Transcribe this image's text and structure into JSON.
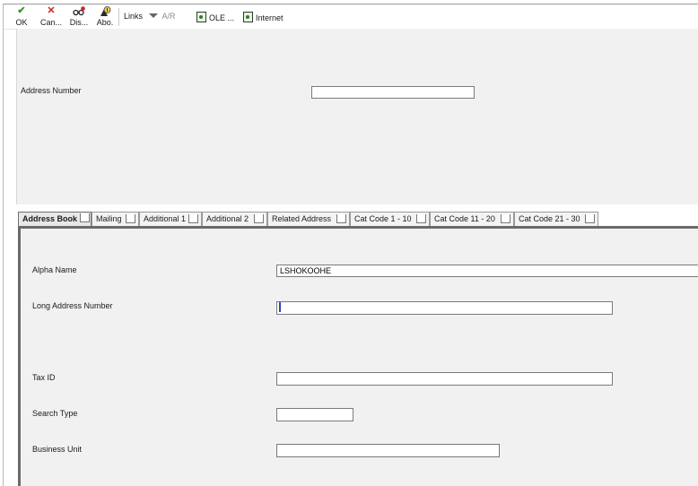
{
  "toolbar": {
    "ok_label": "OK",
    "cancel_label": "Can...",
    "display_label": "Dis...",
    "about_label": "Abo.",
    "links_label": "Links",
    "ar_label": "A/R",
    "ole_label": "OLE ...",
    "internet_label": "Internet"
  },
  "header": {
    "address_number_label": "Address Number",
    "address_number_value": ""
  },
  "tabs": [
    {
      "label": "Address Book"
    },
    {
      "label": "Mailing"
    },
    {
      "label": "Additional 1"
    },
    {
      "label": "Additional 2"
    },
    {
      "label": "Related Address"
    },
    {
      "label": "Cat Code 1 - 10"
    },
    {
      "label": "Cat Code 11 - 20"
    },
    {
      "label": "Cat Code 21 - 30"
    }
  ],
  "form": {
    "alpha_name_label": "Alpha Name",
    "alpha_name_value": "LSHOKOOHE",
    "long_address_label": "Long Address Number",
    "long_address_value": "",
    "tax_id_label": "Tax ID",
    "tax_id_value": "",
    "search_type_label": "Search Type",
    "search_type_value": "",
    "business_unit_label": "Business Unit",
    "business_unit_value": ""
  },
  "colors": {
    "ok_check": "#2e9a2e",
    "cancel_x": "#d42020",
    "ar_disabled": "#8a8a8a"
  }
}
